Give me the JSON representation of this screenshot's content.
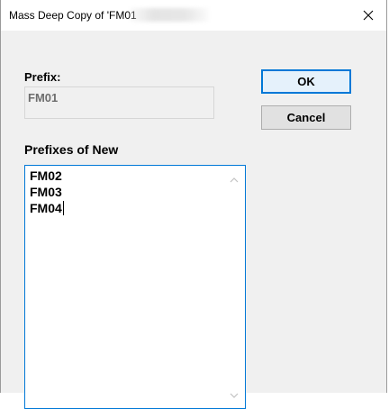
{
  "window": {
    "title": "Mass Deep Copy of 'FM01"
  },
  "icons": {
    "close": "close-icon",
    "scroll_up": "chevron-up-icon",
    "scroll_down": "chevron-down-icon"
  },
  "form": {
    "prefix_label": "Prefix:",
    "prefix_value": "FM01",
    "prefixes_new_label": "Prefixes of New",
    "prefixes_new_lines": [
      "FM02",
      "FM03",
      "FM04"
    ]
  },
  "buttons": {
    "ok_label": "OK",
    "cancel_label": "Cancel"
  },
  "colors": {
    "focus_accent": "#0078d7",
    "disabled_text": "#6d6d6d"
  }
}
